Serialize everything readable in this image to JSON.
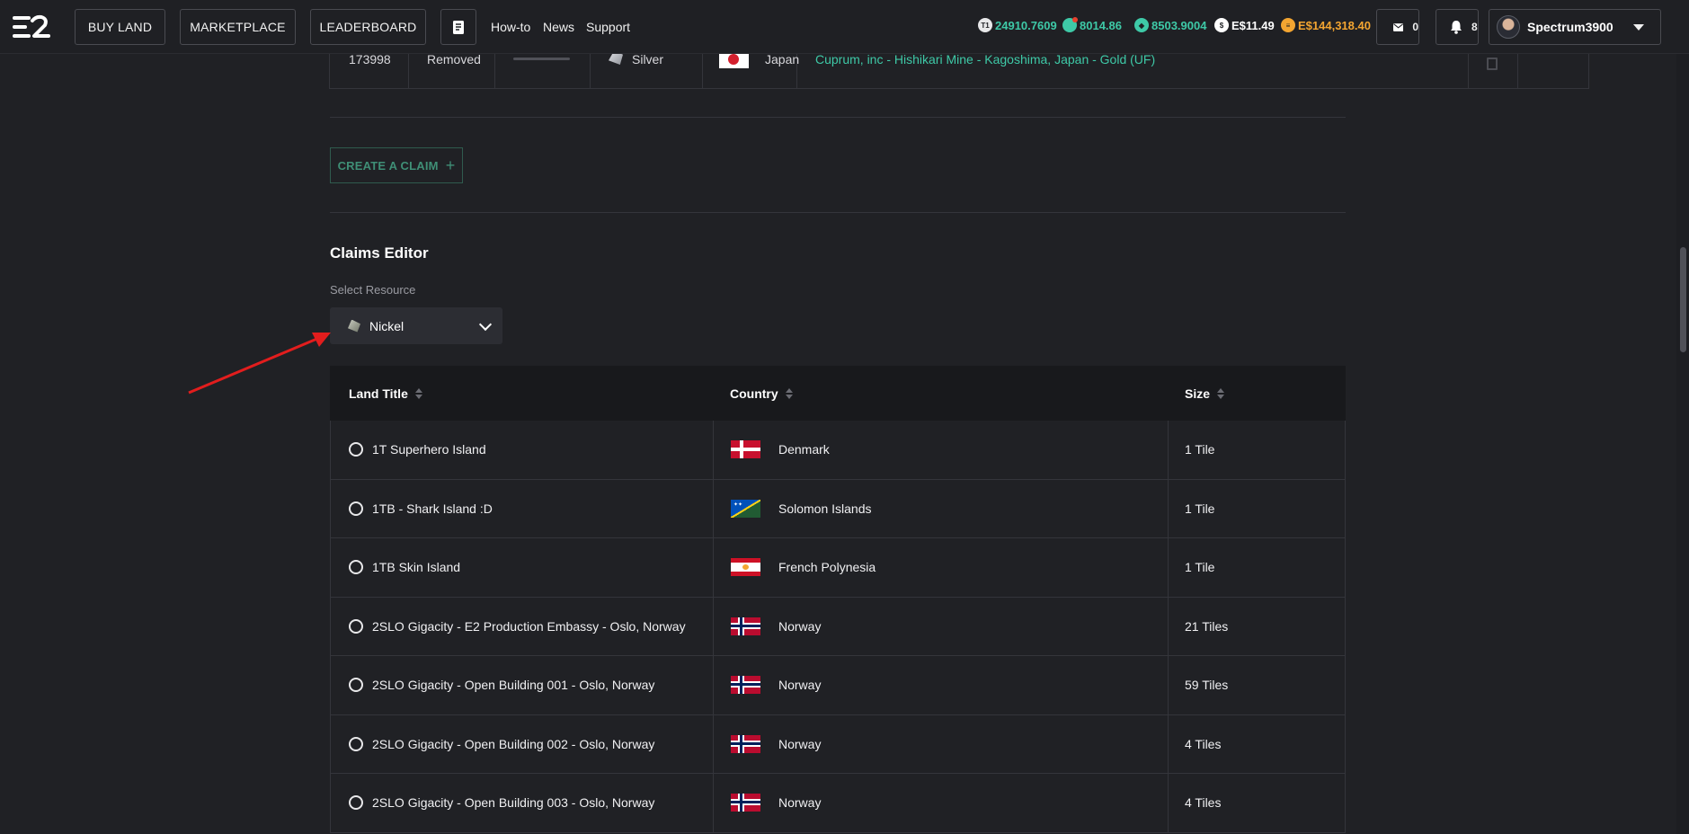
{
  "nav": {
    "buttons": [
      "BUY LAND",
      "MARKETPLACE",
      "LEADERBOARD"
    ],
    "links": [
      "How-to",
      "News",
      "Support"
    ],
    "stats": [
      {
        "icon": "t1-token-icon",
        "value": "24910.7609",
        "color": "#3ec9a7"
      },
      {
        "icon": "gem-token-icon",
        "value": "8014.86",
        "color": "#3ec9a7"
      },
      {
        "icon": "ether-token-icon",
        "value": "8503.9004",
        "color": "#3ec9a7"
      },
      {
        "icon": "dollar-icon",
        "value": "E$11.49",
        "color": "#ffffff"
      },
      {
        "icon": "gold-coin-icon",
        "value": "E$144,318.40",
        "color": "#f3a531"
      }
    ],
    "mail_count": "0",
    "notification_count": "8",
    "username": "Spectrum3900"
  },
  "top_row": {
    "id": "173998",
    "status": "Removed",
    "resource": "Silver",
    "country": "Japan",
    "land_link": "Cuprum, inc - Hishikari Mine - Kagoshima, Japan - Gold (UF)"
  },
  "create_claim_label": "CREATE A CLAIM",
  "editor": {
    "title": "Claims Editor",
    "select_label": "Select Resource",
    "selected_resource": "Nickel"
  },
  "claims_table": {
    "headers": [
      "Land Title",
      "Country",
      "Size"
    ],
    "rows": [
      {
        "title": "1T Superhero Island",
        "country": "Denmark",
        "flag": "denmark",
        "size": "1 Tile"
      },
      {
        "title": "1TB - Shark Island :D",
        "country": "Solomon Islands",
        "flag": "solomon",
        "size": "1 Tile"
      },
      {
        "title": "1TB Skin Island",
        "country": "French Polynesia",
        "flag": "polynesia",
        "size": "1 Tile"
      },
      {
        "title": "2SLO Gigacity - E2 Production Embassy - Oslo, Norway",
        "country": "Norway",
        "flag": "norway",
        "size": "21 Tiles"
      },
      {
        "title": "2SLO Gigacity - Open Building 001 - Oslo, Norway",
        "country": "Norway",
        "flag": "norway",
        "size": "59 Tiles"
      },
      {
        "title": "2SLO Gigacity - Open Building 002 - Oslo, Norway",
        "country": "Norway",
        "flag": "norway",
        "size": "4 Tiles"
      },
      {
        "title": "2SLO Gigacity - Open Building 003 - Oslo, Norway",
        "country": "Norway",
        "flag": "norway",
        "size": "4 Tiles"
      }
    ]
  }
}
